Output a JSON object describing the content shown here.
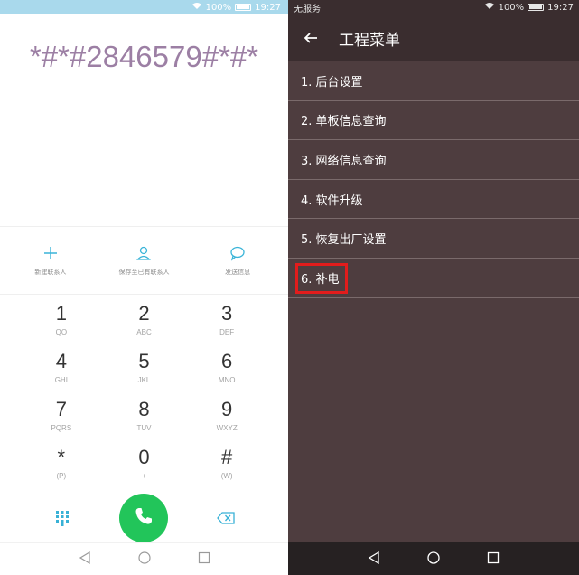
{
  "left": {
    "status": {
      "battery": "100%",
      "time": "19:27"
    },
    "dialed_number": "*#*#2846579#*#*",
    "actions": [
      {
        "label": "新建联系人",
        "icon": "add-contact-icon"
      },
      {
        "label": "保存至已有联系人",
        "icon": "person-icon"
      },
      {
        "label": "发送信息",
        "icon": "message-icon"
      }
    ],
    "keys": [
      {
        "digit": "1",
        "letters": "QO"
      },
      {
        "digit": "2",
        "letters": "ABC"
      },
      {
        "digit": "3",
        "letters": "DEF"
      },
      {
        "digit": "4",
        "letters": "GHI"
      },
      {
        "digit": "5",
        "letters": "JKL"
      },
      {
        "digit": "6",
        "letters": "MNO"
      },
      {
        "digit": "7",
        "letters": "PQRS"
      },
      {
        "digit": "8",
        "letters": "TUV"
      },
      {
        "digit": "9",
        "letters": "WXYZ"
      },
      {
        "digit": "*",
        "letters": "(P)"
      },
      {
        "digit": "0",
        "letters": "+"
      },
      {
        "digit": "#",
        "letters": "(W)"
      }
    ],
    "colors": {
      "call_button": "#22c55a",
      "accent": "#38b1d6",
      "number": "#9c7fa4"
    }
  },
  "right": {
    "status": {
      "carrier": "无服务",
      "battery": "100%",
      "time": "19:27"
    },
    "title": "工程菜单",
    "menu": [
      "1. 后台设置",
      "2. 单板信息查询",
      "3. 网络信息查询",
      "4. 软件升级",
      "5. 恢复出厂设置",
      "6. 补电"
    ],
    "highlight_color": "#e21c1c"
  }
}
